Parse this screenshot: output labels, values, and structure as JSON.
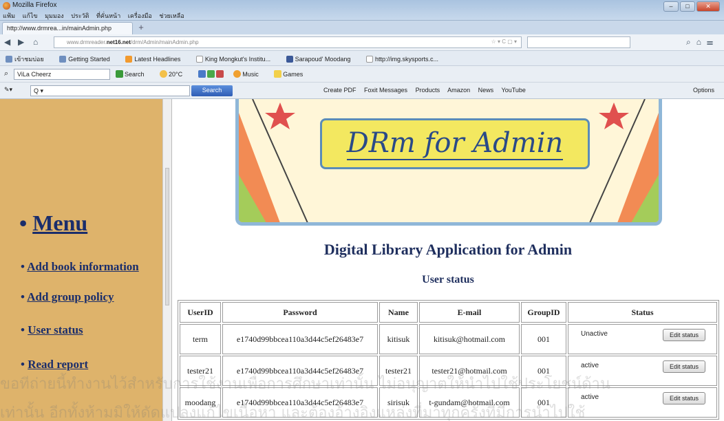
{
  "browser": {
    "window_title": "Mozilla Firefox",
    "menubar": [
      "แฟ้ม",
      "แก้ไข",
      "มุมมอง",
      "ประวัติ",
      "ที่คั่นหน้า",
      "เครื่องมือ",
      "ช่วยเหลือ"
    ],
    "tab_title": "http://www.drmrea...in/mainAdmin.php",
    "url_domain": "net16.net",
    "url_prefix": "www.drmreader.",
    "url_path": "/drm/Admin/mainAdmin.php",
    "bookmarks": [
      "เข้าชมบ่อย",
      "Getting Started",
      "Latest Headlines",
      "King Mongkut's Institu...",
      "Sarapoud' Moodang",
      "http://img.skysports.c..."
    ],
    "toolbar_combo": "ViLa Cheerz",
    "toolbar_items": [
      "Search",
      "20°C",
      "Music",
      "Games"
    ],
    "search_button": "Search",
    "toolbar2_links": [
      "Create PDF",
      "Foxit Messages",
      "Products",
      "Amazon",
      "News",
      "YouTube"
    ],
    "options_label": "Options"
  },
  "banner": {
    "text": "DRm for Admin"
  },
  "sidebar": {
    "menu_title": "Menu",
    "items": [
      "Add book information",
      "Add group policy",
      "User status",
      "Read report"
    ]
  },
  "page": {
    "heading": "Digital Library Application for Admin",
    "subheading": "User status"
  },
  "table": {
    "headers": [
      "UserID",
      "Password",
      "Name",
      "E-mail",
      "GroupID",
      "Status"
    ],
    "rows": [
      {
        "userid": "term",
        "password": "e1740d99bbcea110a3d44c5ef26483e7",
        "name": "kitisuk",
        "email": "kitisuk@hotmail.com",
        "groupid": "001",
        "status": "Unactive",
        "button": "Edit status"
      },
      {
        "userid": "tester21",
        "password": "e1740d99bbcea110a3d44c5ef26483e7",
        "name": "tester21",
        "email": "tester21@hotmail.com",
        "groupid": "001",
        "status": "active",
        "button": "Edit status"
      },
      {
        "userid": "moodang",
        "password": "e1740d99bbcea110a3d44c5ef26483e7",
        "name": "sirisuk",
        "email": "t-gundam@hotmail.com",
        "groupid": "001",
        "status": "active",
        "button": "Edit status"
      }
    ]
  },
  "watermark": {
    "line1": "ขอทีถ่ายนี้ทำงานไว้สำหรับการใช้งานเพื่อการศึกษาเท่านั้น ไม่อนุญาตให้นำไปใช้ประโยชน์ด้าน",
    "line2": "เท่านั้น อีกทั้งห้ามมิให้ดัดแปลงแก้ไขเนื้อหา และต้องอ้างอิงแหล่งที่มาทุกครั้งที่มีการนำไปใช้"
  }
}
